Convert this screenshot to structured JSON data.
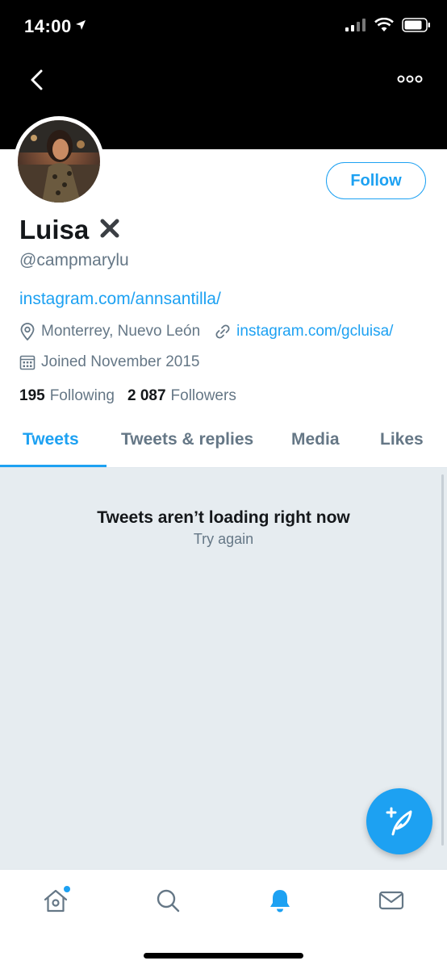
{
  "status_bar": {
    "time": "14:00"
  },
  "profile": {
    "display_name": "Luisa",
    "name_suffix": "✖",
    "handle": "@campmarylu",
    "bio_link": "instagram.com/annsantilla/",
    "location": "Monterrey, Nuevo León",
    "website": "instagram.com/gcluisa/",
    "joined": "Joined November 2015",
    "following_count": "195",
    "following_label": "Following",
    "followers_count": "2 087",
    "followers_label": "Followers",
    "follow_button": "Follow"
  },
  "tabs": [
    {
      "label": "Tweets",
      "active": true
    },
    {
      "label": "Tweets & replies",
      "active": false
    },
    {
      "label": "Media",
      "active": false
    },
    {
      "label": "Likes",
      "active": false
    }
  ],
  "timeline": {
    "error_title": "Tweets aren’t loading right now",
    "retry_label": "Try again"
  },
  "tab_bar": [
    {
      "icon": "home-icon",
      "badge": true
    },
    {
      "icon": "search-icon",
      "badge": false
    },
    {
      "icon": "notifications-icon",
      "active": true
    },
    {
      "icon": "messages-icon",
      "badge": false
    }
  ],
  "colors": {
    "accent": "#1da1f2",
    "secondary_text": "#657786",
    "timeline_bg": "#e6ecf0"
  }
}
